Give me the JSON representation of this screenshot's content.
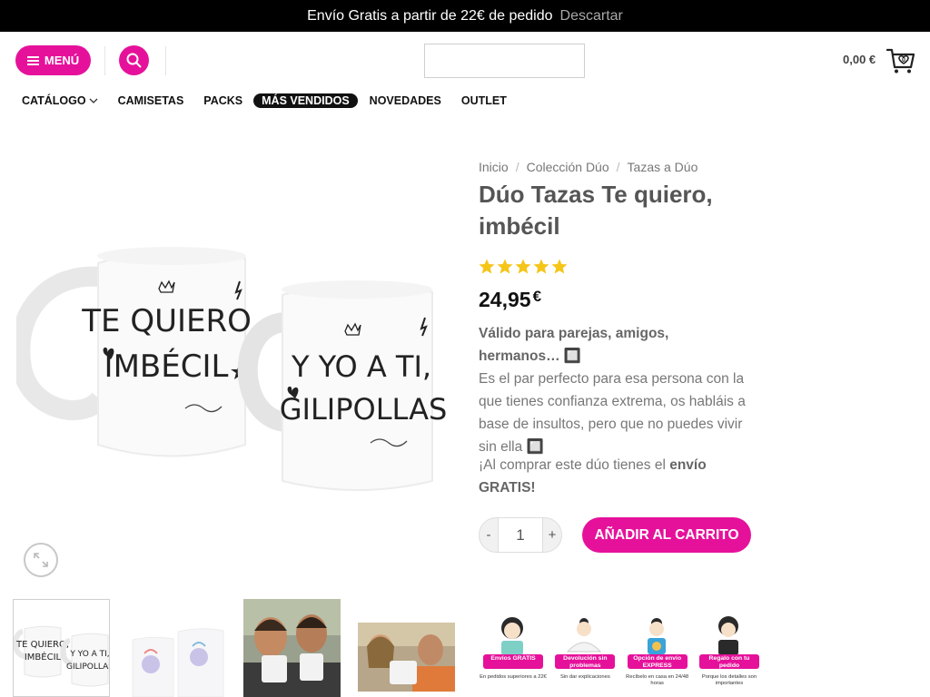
{
  "topbar": {
    "message": "Envío Gratis a partir de 22€ de pedido",
    "dismiss": "Descartar"
  },
  "header": {
    "menu_label": "MENÚ",
    "cart_total": "0,00 €",
    "cart_count": "0"
  },
  "nav": [
    {
      "label": "CATÁLOGO",
      "dropdown": true
    },
    {
      "label": "CAMISETAS"
    },
    {
      "label": "PACKS"
    },
    {
      "label": "MÁS VENDIDOS",
      "active": true
    },
    {
      "label": "NOVEDADES"
    },
    {
      "label": "OUTLET"
    }
  ],
  "breadcrumb": [
    "Inicio",
    "Colección Dúo",
    "Tazas a Dúo"
  ],
  "product": {
    "title": "Dúo Tazas Te quiero, imbécil",
    "rating": 5,
    "price": "24,95",
    "currency": "€",
    "desc_bold": "Válido para parejas, amigos, hermanos… 🔲",
    "desc_text": "Es el par perfecto para esa persona con la que tienes confianza extrema, os habláis a base de insultos, pero que no puedes vivir sin ella 🔲",
    "promo_pre": "¡Al comprar este dúo tienes el ",
    "promo_bold": "envío GRATIS!",
    "qty": "1",
    "minus": "-",
    "plus": "+",
    "add_to_cart": "AÑADIR AL CARRITO"
  },
  "mug": {
    "left_text_1": "TE QUIERO,",
    "left_text_2": "IMBÉCIL",
    "right_text_1": "Y YO A TI,",
    "right_text_2": "GILIPOLLAS"
  },
  "badges": [
    {
      "title": "Envíos GRATIS",
      "sub": "En pedidos superiores a 22€"
    },
    {
      "title": "Devolución sin problemas",
      "sub": "Sin dar explicaciones"
    },
    {
      "title": "Opción de envío EXPRESS",
      "sub": "Recíbelo en casa en 24/48 horas"
    },
    {
      "title": "Regalo con tu pedido",
      "sub": "Porque los detalles son importantes"
    }
  ],
  "colors": {
    "accent": "#e6119a",
    "topbar": "#000000",
    "star": "#f5c518"
  }
}
